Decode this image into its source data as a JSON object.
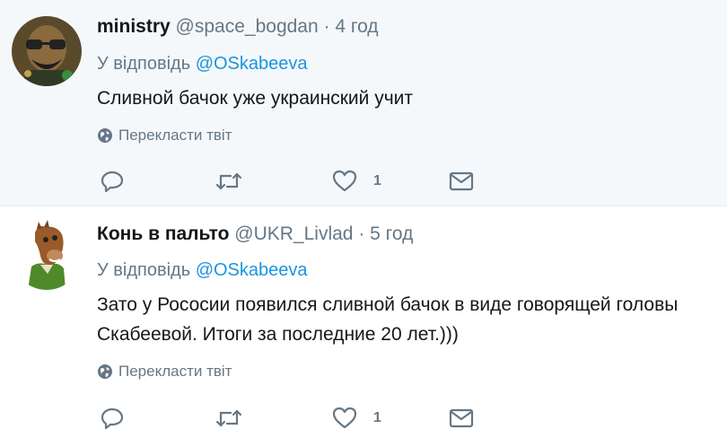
{
  "tweets": [
    {
      "fullname": "ministry",
      "handle": "@space_bogdan",
      "separator": "·",
      "time": "4 год",
      "reply_prefix": "У відповідь",
      "reply_mention": "@OSkabeeva",
      "text": "Сливной бачок уже украинский учит",
      "translate_label": "Перекласти твіт",
      "like_count": "1",
      "avatar_icon": "person-with-glasses-avatar"
    },
    {
      "fullname": "Конь в пальто",
      "handle": "@UKR_Livlad",
      "separator": "·",
      "time": "5 год",
      "reply_prefix": "У відповідь",
      "reply_mention": "@OSkabeeva",
      "text": "Зато у Рососии появился сливной бачок в виде говорящей головы Скабеевой. Итоги за последние 20 лет.)))",
      "translate_label": "Перекласти твіт",
      "like_count": "1",
      "avatar_icon": "horse-in-coat-avatar"
    }
  ],
  "colors": {
    "link": "#1b95e0",
    "muted": "#657786",
    "text": "#14171a",
    "highlight_bg": "#f5f8fa"
  },
  "icons": [
    "globe-icon",
    "reply-icon",
    "retweet-icon",
    "heart-icon",
    "envelope-icon"
  ]
}
